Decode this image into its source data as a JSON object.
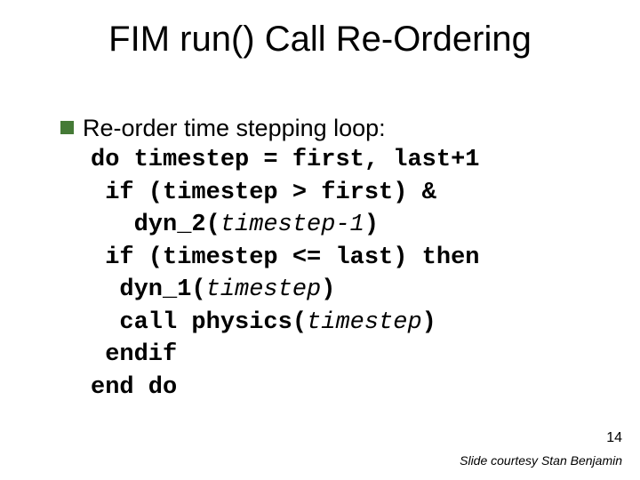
{
  "title": "FIM run() Call Re-Ordering",
  "bullet": "Re-order time stepping loop:",
  "code": {
    "l1": "do timestep = first, last+1",
    "l2": " if (timestep > first) &",
    "l3_a": "   dyn_2(",
    "l3_arg": "timestep-1",
    "l3_b": ")",
    "l4": " if (timestep <= last) then",
    "l5_a": "  dyn_1(",
    "l5_arg": "timestep",
    "l5_b": ")",
    "l6_a": "  call physics(",
    "l6_arg": "timestep",
    "l6_b": ")",
    "l7": " endif",
    "l8": "end do"
  },
  "page_number": "14",
  "credit": "Slide courtesy Stan Benjamin"
}
